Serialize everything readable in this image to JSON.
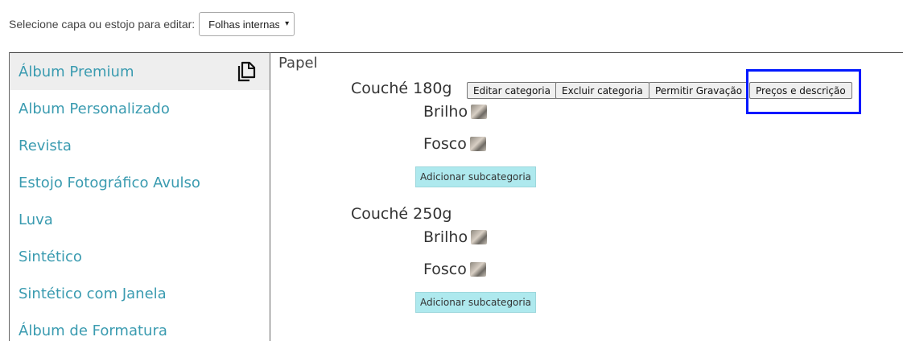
{
  "header": {
    "label": "Selecione capa ou estojo para editar:",
    "select_value": "Folhas internas",
    "select_arrow": "▾"
  },
  "sidebar": {
    "items": [
      {
        "label": "Álbum Premium"
      },
      {
        "label": "Album Personalizado"
      },
      {
        "label": "Revista"
      },
      {
        "label": "Estojo Fotográfico Avulso"
      },
      {
        "label": "Luva"
      },
      {
        "label": "Sintético"
      },
      {
        "label": "Sintético com Janela"
      },
      {
        "label": "Álbum de Formatura"
      }
    ]
  },
  "main": {
    "section_title": "Papel",
    "categories": [
      {
        "name": "Couché 180g",
        "subcategories": [
          {
            "name": "Brilho"
          },
          {
            "name": "Fosco"
          }
        ],
        "add_label": "Adicionar subcategoria"
      },
      {
        "name": "Couché 250g",
        "subcategories": [
          {
            "name": "Brilho"
          },
          {
            "name": "Fosco"
          }
        ],
        "add_label": "Adicionar subcategoria"
      }
    ],
    "actions": {
      "edit": "Editar categoria",
      "delete": "Excluir categoria",
      "allow_engraving": "Permitir Gravação",
      "prices": "Preços e descrição"
    }
  },
  "colors": {
    "link": "#3a9bb0",
    "add_button_bg": "#aee9ee",
    "highlight": "#0018ff"
  }
}
